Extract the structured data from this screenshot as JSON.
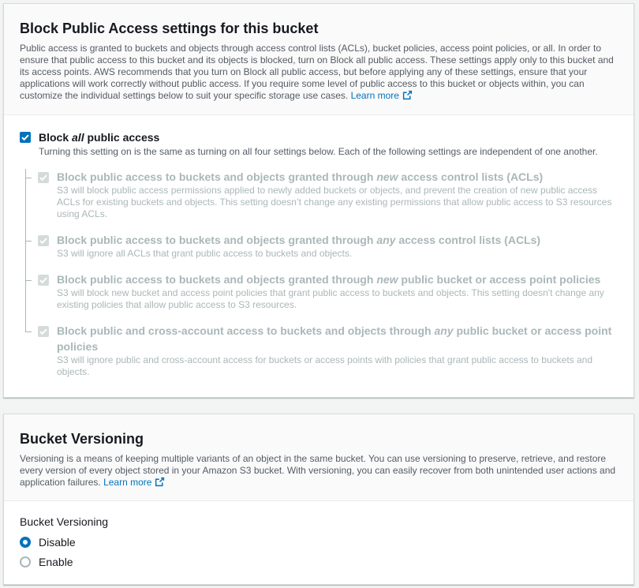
{
  "bpa": {
    "title": "Block Public Access settings for this bucket",
    "description": "Public access is granted to buckets and objects through access control lists (ACLs), bucket policies, access point policies, or all. In order to ensure that public access to this bucket and its objects is blocked, turn on Block all public access. These settings apply only to this bucket and its access points. AWS recommends that you turn on Block all public access, but before applying any of these settings, ensure that your applications will work correctly without public access. If you require some level of public access to this bucket or objects within, you can customize the individual settings below to suit your specific storage use cases.",
    "learn_more": "Learn more",
    "block_all": {
      "label_prefix": "Block ",
      "label_emph": "all",
      "label_suffix": " public access",
      "checked": true,
      "description": "Turning this setting on is the same as turning on all four settings below. Each of the following settings are independent of one another."
    },
    "options": [
      {
        "label_prefix": "Block public access to buckets and objects granted through ",
        "label_emph": "new",
        "label_suffix": " access control lists (ACLs)",
        "description": "S3 will block public access permissions applied to newly added buckets or objects, and prevent the creation of new public access ACLs for existing buckets and objects. This setting doesn’t change any existing permissions that allow public access to S3 resources using ACLs.",
        "checked": true
      },
      {
        "label_prefix": "Block public access to buckets and objects granted through ",
        "label_emph": "any",
        "label_suffix": " access control lists (ACLs)",
        "description": "S3 will ignore all ACLs that grant public access to buckets and objects.",
        "checked": true
      },
      {
        "label_prefix": "Block public access to buckets and objects granted through ",
        "label_emph": "new",
        "label_suffix": " public bucket or access point policies",
        "description": "S3 will block new bucket and access point policies that grant public access to buckets and objects. This setting doesn't change any existing policies that allow public access to S3 resources.",
        "checked": true
      },
      {
        "label_prefix": "Block public and cross-account access to buckets and objects through ",
        "label_emph": "any",
        "label_suffix": " public bucket or access point policies",
        "description": "S3 will ignore public and cross-account access for buckets or access points with policies that grant public access to buckets and objects.",
        "checked": true
      }
    ]
  },
  "versioning": {
    "title": "Bucket Versioning",
    "description": "Versioning is a means of keeping multiple variants of an object in the same bucket. You can use versioning to preserve, retrieve, and restore every version of every object stored in your Amazon S3 bucket. With versioning, you can easily recover from both unintended user actions and application failures.",
    "learn_more": "Learn more",
    "field_label": "Bucket Versioning",
    "options": [
      "Disable",
      "Enable"
    ],
    "selected": "Disable"
  },
  "colors": {
    "accent": "#0073bb",
    "disabled": "#aab7b8",
    "text": "#16191f",
    "secondary_text": "#545b64"
  }
}
